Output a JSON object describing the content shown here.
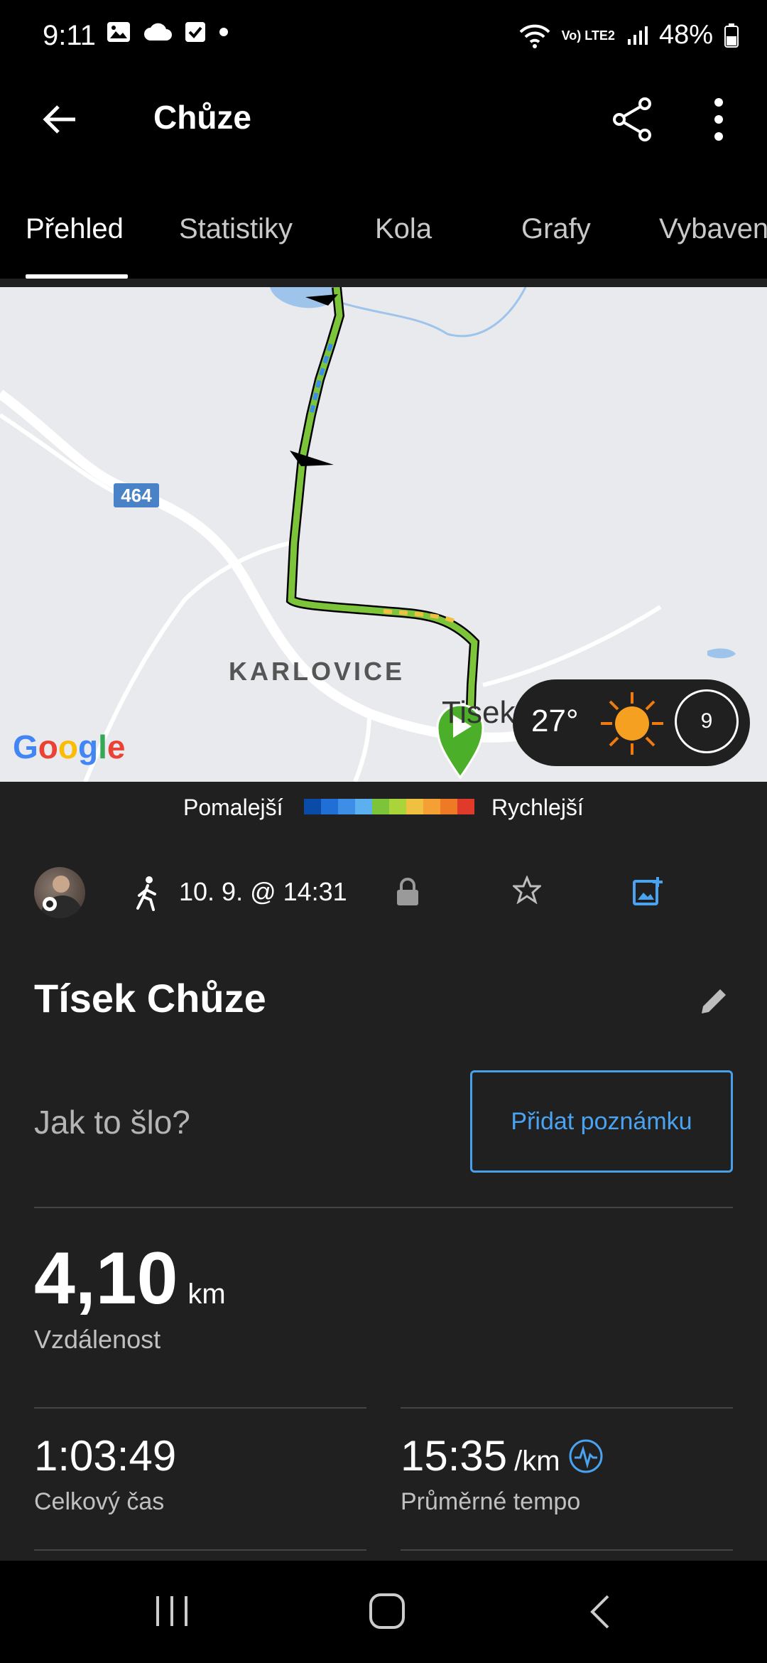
{
  "status_bar": {
    "time": "9:11",
    "network_label": "Vo) LTE2",
    "battery": "48%"
  },
  "app_bar": {
    "title": "Chůze"
  },
  "tabs": [
    {
      "label": "Přehled",
      "active": true
    },
    {
      "label": "Statistiky"
    },
    {
      "label": "Kola"
    },
    {
      "label": "Grafy"
    },
    {
      "label": "Vybaven"
    }
  ],
  "map": {
    "place_label": "KARLOVICE",
    "road_number": "464",
    "town_label": "Tisek",
    "provider": "Google"
  },
  "weather": {
    "temperature": "27°",
    "wind": "9"
  },
  "legend": {
    "slower": "Pomalejší",
    "faster": "Rychlejší",
    "colors": [
      "#0a4ba8",
      "#1f6fd6",
      "#3e8ee8",
      "#5cb0f0",
      "#7cc43a",
      "#a9d43a",
      "#f0c040",
      "#f5a035",
      "#ef7a26",
      "#e03a2a"
    ]
  },
  "activity": {
    "date_time": "10. 9. @ 14:31",
    "title": "Tísek Chůze",
    "note_prompt": "Jak to šlo?",
    "add_note_label": "Přidat poznámku"
  },
  "stats": {
    "distance": {
      "value": "4,10",
      "unit": "km",
      "label": "Vzdálenost"
    },
    "total_time": {
      "value": "1:03:49",
      "label": "Celkový čas"
    },
    "avg_pace": {
      "value": "15:35",
      "unit": "/km",
      "label": "Průměrné tempo"
    }
  },
  "colors": {
    "accent": "#4aa3f0",
    "background": "#202020",
    "route_green": "#7cc43a"
  }
}
